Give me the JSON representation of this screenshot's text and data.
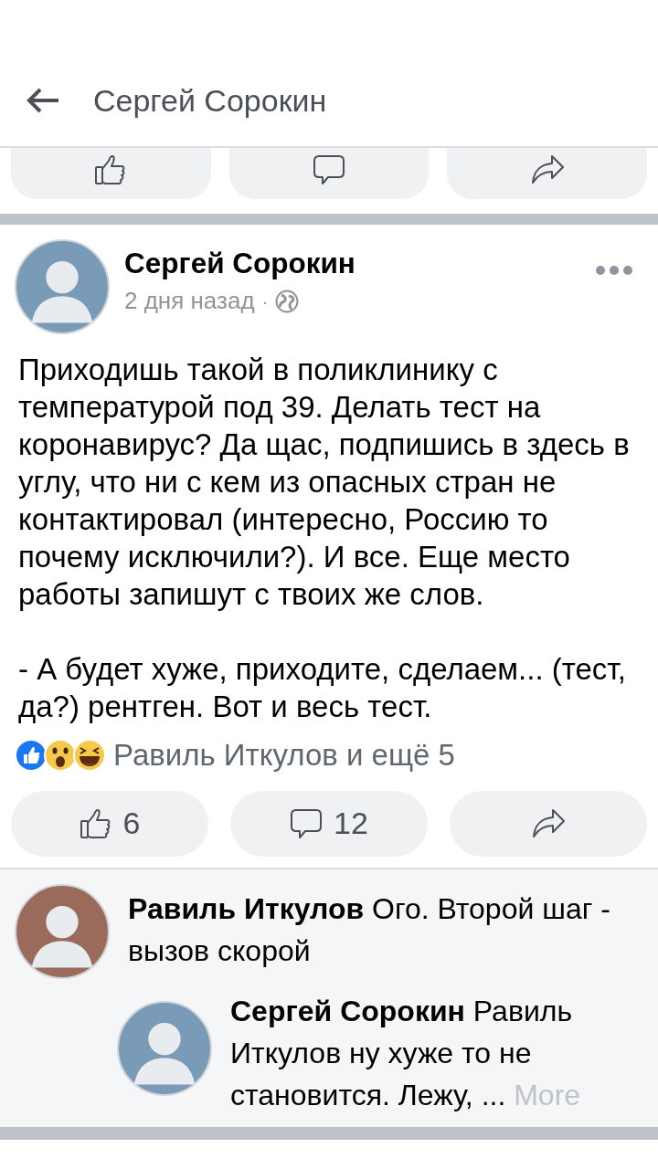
{
  "header": {
    "title": "Сергей Сорокин"
  },
  "previous_post_actions": [
    {
      "kind": "like"
    },
    {
      "kind": "comment"
    },
    {
      "kind": "share"
    }
  ],
  "post": {
    "author": "Сергей Сорокин",
    "time": "2 дня назад",
    "separator": "·",
    "paragraphs": [
      "Приходишь такой в поликлинику с температурой под 39. Делать тест на коронавирус? Да щас, подпишись в здесь в углу, что ни с кем из опасных стран не контактировал (интересно, Россию то почему исключили?). И все. Еще место работы запишут с твоих же слов.",
      "- А будет хуже, приходите, сделаем... (тест, да?) рентген. Вот и весь тест."
    ],
    "reactions": {
      "icons": [
        {
          "kind": "like"
        },
        {
          "kind": "wow"
        },
        {
          "kind": "haha"
        }
      ],
      "summary": "Равиль Иткулов и ещё 5"
    },
    "actions": [
      {
        "kind": "like",
        "count": "6"
      },
      {
        "kind": "comment",
        "count": "12"
      },
      {
        "kind": "share"
      }
    ]
  },
  "comments": [
    {
      "author": "Равиль Иткулов",
      "text": "Ого. Второй шаг - вызов скорой",
      "replies": [
        {
          "author": "Сергей Сорокин",
          "text": "Равиль Иткулов ну хуже то не становится. Лежу, ...",
          "more": "More"
        }
      ]
    }
  ]
}
